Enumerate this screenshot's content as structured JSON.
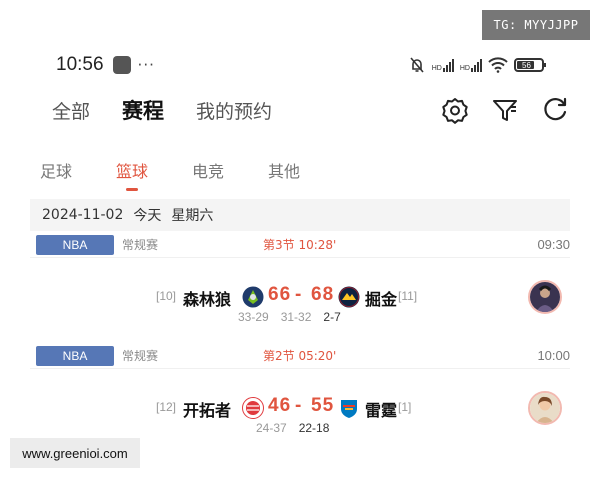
{
  "watermarks": {
    "tg": "TG: MYYJJPP",
    "url": "www.greenioi.com"
  },
  "status_bar": {
    "time": "10:56",
    "more": "···",
    "battery": "56",
    "signal_labels": [
      "HD",
      "HD"
    ]
  },
  "top_nav": {
    "tabs": [
      "全部",
      "赛程",
      "我的预约"
    ],
    "active": "赛程"
  },
  "sport_tabs": {
    "tabs": [
      "足球",
      "篮球",
      "电竞",
      "其他"
    ],
    "active": "篮球"
  },
  "date_bar": {
    "date": "2024-11-02",
    "relative": "今天",
    "weekday": "星期六"
  },
  "matches": [
    {
      "league": "NBA",
      "type": "常规赛",
      "period": "第3节 10:28'",
      "kickoff": "09:30",
      "home_rank": "[10]",
      "home_team": "森林狼",
      "home_score": "66",
      "separator": "-",
      "away_score": "68",
      "away_team": "掘金",
      "away_rank": "[11]",
      "quarters": [
        "33-29",
        "31-32"
      ],
      "current_quarter": "2-7",
      "home_logo_color": "#1f3b6b",
      "away_logo_color": "#0e2240"
    },
    {
      "league": "NBA",
      "type": "常规赛",
      "period": "第2节 05:20'",
      "kickoff": "10:00",
      "home_rank": "[12]",
      "home_team": "开拓者",
      "home_score": "46",
      "separator": "-",
      "away_score": "55",
      "away_team": "雷霆",
      "away_rank": "[1]",
      "quarters": [
        "24-37"
      ],
      "current_quarter": "22-18",
      "home_logo_color": "#e03a3e",
      "away_logo_color": "#007ac1"
    }
  ],
  "colors": {
    "accent": "#e0553f",
    "league_badge": "#5677b6",
    "date_bar_bg": "#f4f4f4"
  }
}
